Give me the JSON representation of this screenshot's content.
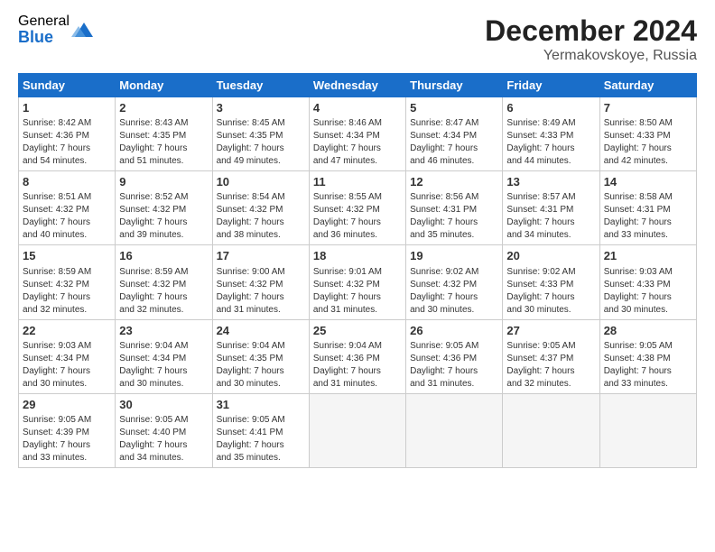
{
  "logo": {
    "general": "General",
    "blue": "Blue"
  },
  "title": {
    "month": "December 2024",
    "location": "Yermakovskoye, Russia"
  },
  "weekdays": [
    "Sunday",
    "Monday",
    "Tuesday",
    "Wednesday",
    "Thursday",
    "Friday",
    "Saturday"
  ],
  "weeks": [
    [
      {
        "day": "1",
        "info": "Sunrise: 8:42 AM\nSunset: 4:36 PM\nDaylight: 7 hours\nand 54 minutes."
      },
      {
        "day": "2",
        "info": "Sunrise: 8:43 AM\nSunset: 4:35 PM\nDaylight: 7 hours\nand 51 minutes."
      },
      {
        "day": "3",
        "info": "Sunrise: 8:45 AM\nSunset: 4:35 PM\nDaylight: 7 hours\nand 49 minutes."
      },
      {
        "day": "4",
        "info": "Sunrise: 8:46 AM\nSunset: 4:34 PM\nDaylight: 7 hours\nand 47 minutes."
      },
      {
        "day": "5",
        "info": "Sunrise: 8:47 AM\nSunset: 4:34 PM\nDaylight: 7 hours\nand 46 minutes."
      },
      {
        "day": "6",
        "info": "Sunrise: 8:49 AM\nSunset: 4:33 PM\nDaylight: 7 hours\nand 44 minutes."
      },
      {
        "day": "7",
        "info": "Sunrise: 8:50 AM\nSunset: 4:33 PM\nDaylight: 7 hours\nand 42 minutes."
      }
    ],
    [
      {
        "day": "8",
        "info": "Sunrise: 8:51 AM\nSunset: 4:32 PM\nDaylight: 7 hours\nand 40 minutes."
      },
      {
        "day": "9",
        "info": "Sunrise: 8:52 AM\nSunset: 4:32 PM\nDaylight: 7 hours\nand 39 minutes."
      },
      {
        "day": "10",
        "info": "Sunrise: 8:54 AM\nSunset: 4:32 PM\nDaylight: 7 hours\nand 38 minutes."
      },
      {
        "day": "11",
        "info": "Sunrise: 8:55 AM\nSunset: 4:32 PM\nDaylight: 7 hours\nand 36 minutes."
      },
      {
        "day": "12",
        "info": "Sunrise: 8:56 AM\nSunset: 4:31 PM\nDaylight: 7 hours\nand 35 minutes."
      },
      {
        "day": "13",
        "info": "Sunrise: 8:57 AM\nSunset: 4:31 PM\nDaylight: 7 hours\nand 34 minutes."
      },
      {
        "day": "14",
        "info": "Sunrise: 8:58 AM\nSunset: 4:31 PM\nDaylight: 7 hours\nand 33 minutes."
      }
    ],
    [
      {
        "day": "15",
        "info": "Sunrise: 8:59 AM\nSunset: 4:32 PM\nDaylight: 7 hours\nand 32 minutes."
      },
      {
        "day": "16",
        "info": "Sunrise: 8:59 AM\nSunset: 4:32 PM\nDaylight: 7 hours\nand 32 minutes."
      },
      {
        "day": "17",
        "info": "Sunrise: 9:00 AM\nSunset: 4:32 PM\nDaylight: 7 hours\nand 31 minutes."
      },
      {
        "day": "18",
        "info": "Sunrise: 9:01 AM\nSunset: 4:32 PM\nDaylight: 7 hours\nand 31 minutes."
      },
      {
        "day": "19",
        "info": "Sunrise: 9:02 AM\nSunset: 4:32 PM\nDaylight: 7 hours\nand 30 minutes."
      },
      {
        "day": "20",
        "info": "Sunrise: 9:02 AM\nSunset: 4:33 PM\nDaylight: 7 hours\nand 30 minutes."
      },
      {
        "day": "21",
        "info": "Sunrise: 9:03 AM\nSunset: 4:33 PM\nDaylight: 7 hours\nand 30 minutes."
      }
    ],
    [
      {
        "day": "22",
        "info": "Sunrise: 9:03 AM\nSunset: 4:34 PM\nDaylight: 7 hours\nand 30 minutes."
      },
      {
        "day": "23",
        "info": "Sunrise: 9:04 AM\nSunset: 4:34 PM\nDaylight: 7 hours\nand 30 minutes."
      },
      {
        "day": "24",
        "info": "Sunrise: 9:04 AM\nSunset: 4:35 PM\nDaylight: 7 hours\nand 30 minutes."
      },
      {
        "day": "25",
        "info": "Sunrise: 9:04 AM\nSunset: 4:36 PM\nDaylight: 7 hours\nand 31 minutes."
      },
      {
        "day": "26",
        "info": "Sunrise: 9:05 AM\nSunset: 4:36 PM\nDaylight: 7 hours\nand 31 minutes."
      },
      {
        "day": "27",
        "info": "Sunrise: 9:05 AM\nSunset: 4:37 PM\nDaylight: 7 hours\nand 32 minutes."
      },
      {
        "day": "28",
        "info": "Sunrise: 9:05 AM\nSunset: 4:38 PM\nDaylight: 7 hours\nand 33 minutes."
      }
    ],
    [
      {
        "day": "29",
        "info": "Sunrise: 9:05 AM\nSunset: 4:39 PM\nDaylight: 7 hours\nand 33 minutes."
      },
      {
        "day": "30",
        "info": "Sunrise: 9:05 AM\nSunset: 4:40 PM\nDaylight: 7 hours\nand 34 minutes."
      },
      {
        "day": "31",
        "info": "Sunrise: 9:05 AM\nSunset: 4:41 PM\nDaylight: 7 hours\nand 35 minutes."
      },
      {
        "day": "",
        "info": ""
      },
      {
        "day": "",
        "info": ""
      },
      {
        "day": "",
        "info": ""
      },
      {
        "day": "",
        "info": ""
      }
    ]
  ]
}
